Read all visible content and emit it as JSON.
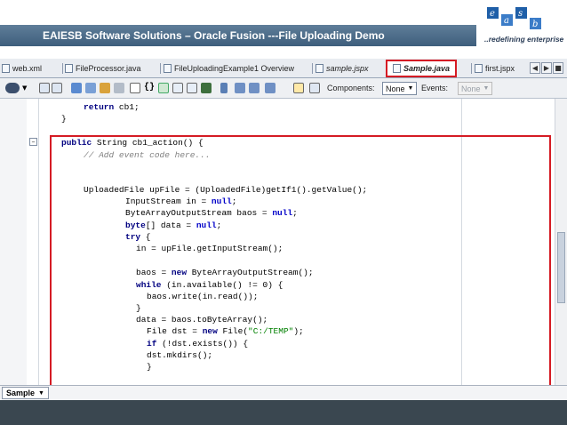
{
  "header": {
    "title": "EAIESB  Software Solutions – Oracle Fusion ---File Uploading Demo",
    "logo_letters": [
      "e",
      "a",
      "s",
      "b"
    ],
    "tagline": "..redefining enterprise"
  },
  "tabs": [
    {
      "label": "web.xml"
    },
    {
      "label": "FileProcessor.java"
    },
    {
      "label": "FileUploadingExample1 Overview"
    },
    {
      "label": "sample.jspx"
    },
    {
      "label": "Sample.java"
    },
    {
      "label": "first.jspx"
    }
  ],
  "toolbar": {
    "components_label": "Components:",
    "components_value": "None",
    "events_label": "Events:",
    "events_value": "None"
  },
  "code": [
    {
      "text": "return cb1;"
    },
    {
      "text": "}"
    },
    {
      "text": "public String cb1_action() {"
    },
    {
      "text": "// Add event code here..."
    },
    {
      "text": "UploadedFile upFile = (UploadedFile)getIf1().getValue();"
    },
    {
      "text": "InputStream in = null;"
    },
    {
      "text": "ByteArrayOutputStream baos = null;"
    },
    {
      "text": "byte[] data = null;"
    },
    {
      "text": "try {"
    },
    {
      "text": "in = upFile.getInputStream();"
    },
    {
      "text": "baos = new ByteArrayOutputStream();"
    },
    {
      "text": "while (in.available() != 0) {"
    },
    {
      "text": "baos.write(in.read());"
    },
    {
      "text": "}"
    },
    {
      "text": "data = baos.toByteArray();"
    },
    {
      "text": "File dst = new File(\"C:/TEMP\");"
    },
    {
      "text": "if (!dst.exists()) {"
    },
    {
      "text": "dst.mkdirs();"
    },
    {
      "text": "}"
    }
  ],
  "bottom_tab": {
    "label": "Sample"
  },
  "colors": {
    "highlight": "#d51b24",
    "banner": "#4a6a88",
    "footer": "#3a4750"
  }
}
